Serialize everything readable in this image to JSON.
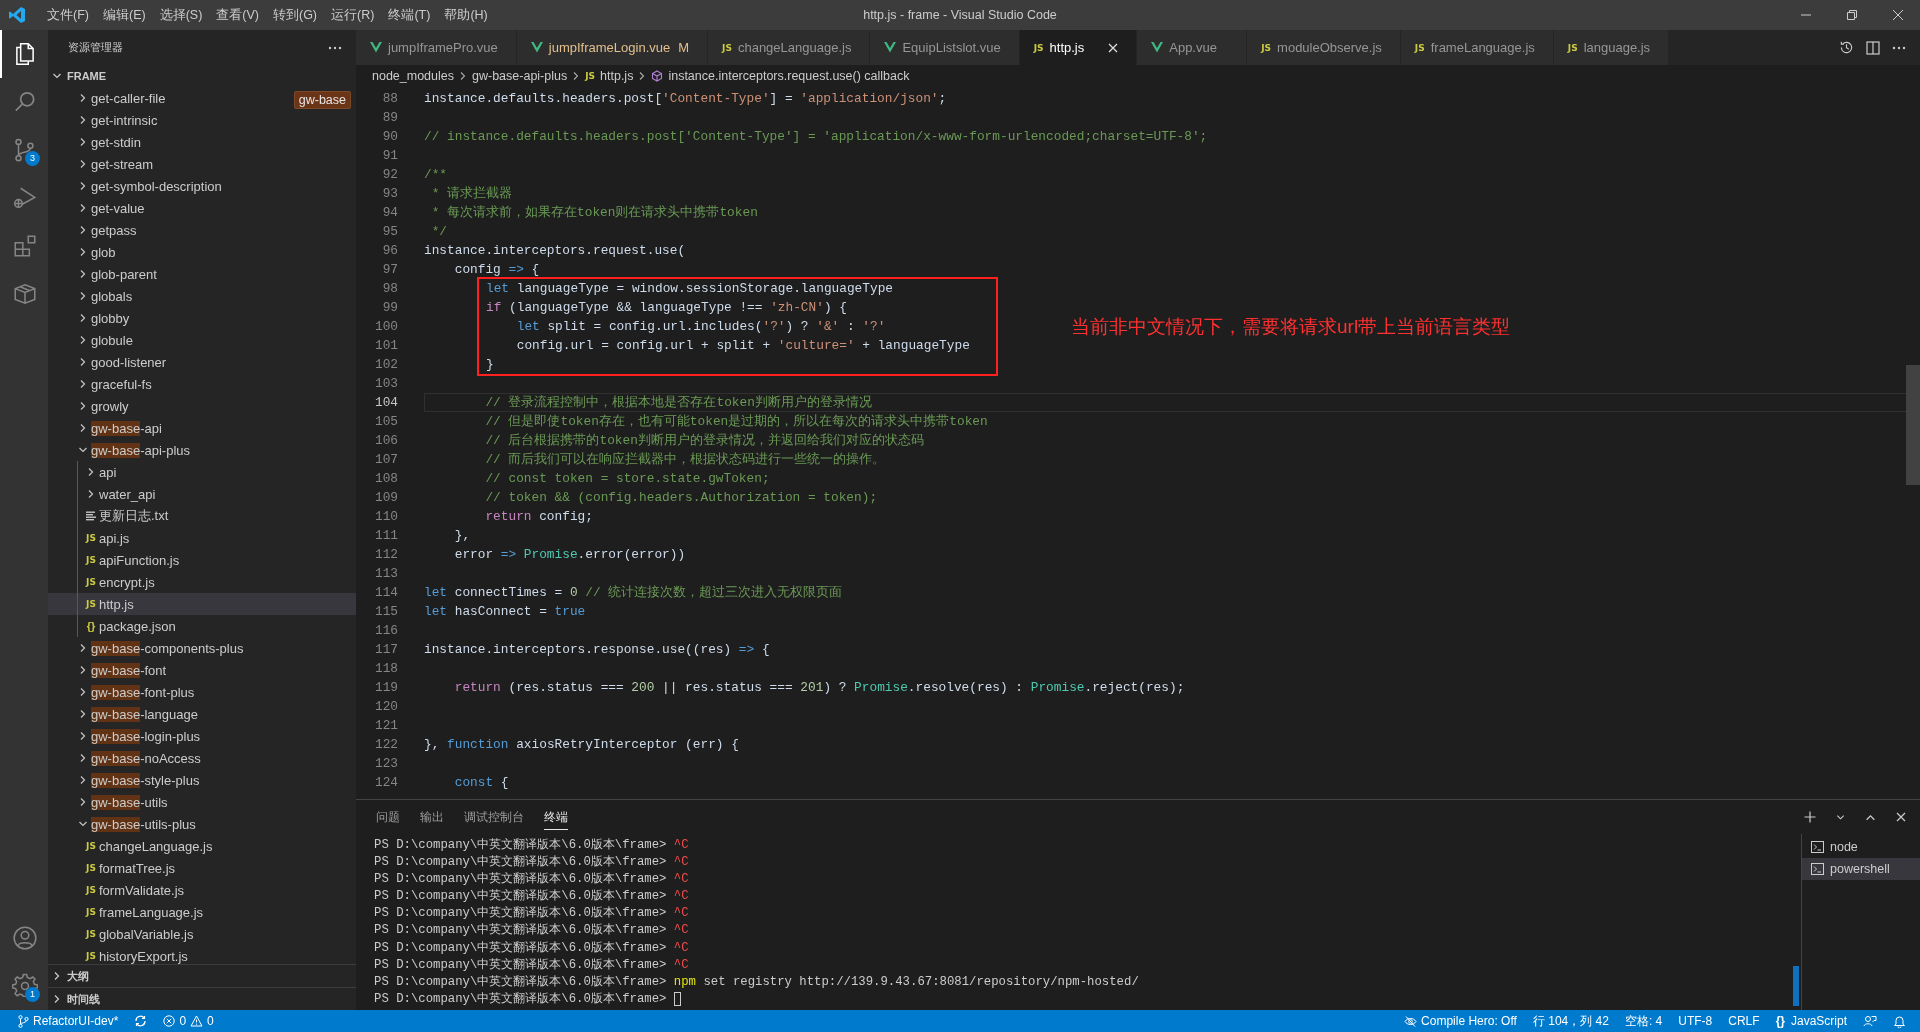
{
  "window": {
    "title": "http.js - frame - Visual Studio Code"
  },
  "menu": [
    "文件(F)",
    "编辑(E)",
    "选择(S)",
    "查看(V)",
    "转到(G)",
    "运行(R)",
    "终端(T)",
    "帮助(H)"
  ],
  "activity_bar": [
    {
      "kind": "explorer",
      "selected": true
    },
    {
      "kind": "search",
      "selected": false
    },
    {
      "kind": "scm",
      "selected": false,
      "badge": "3"
    },
    {
      "kind": "run",
      "selected": false
    },
    {
      "kind": "extensions",
      "selected": false
    },
    {
      "kind": "package",
      "selected": false
    }
  ],
  "activity_bottom": [
    {
      "kind": "account"
    },
    {
      "kind": "settings",
      "badge": "1"
    }
  ],
  "sidebar": {
    "title": "资源管理器",
    "section": "FRAME",
    "filter_badge": "gw-base",
    "tree": [
      {
        "kind": "folder",
        "label": "get-caller-file",
        "expanded": false
      },
      {
        "kind": "folder",
        "label": "get-intrinsic",
        "expanded": false
      },
      {
        "kind": "folder",
        "label": "get-stdin",
        "expanded": false
      },
      {
        "kind": "folder",
        "label": "get-stream",
        "expanded": false
      },
      {
        "kind": "folder",
        "label": "get-symbol-description",
        "expanded": false
      },
      {
        "kind": "folder",
        "label": "get-value",
        "expanded": false
      },
      {
        "kind": "folder",
        "label": "getpass",
        "expanded": false
      },
      {
        "kind": "folder",
        "label": "glob",
        "expanded": false
      },
      {
        "kind": "folder",
        "label": "glob-parent",
        "expanded": false
      },
      {
        "kind": "folder",
        "label": "globals",
        "expanded": false
      },
      {
        "kind": "folder",
        "label": "globby",
        "expanded": false
      },
      {
        "kind": "folder",
        "label": "globule",
        "expanded": false
      },
      {
        "kind": "folder",
        "label": "good-listener",
        "expanded": false
      },
      {
        "kind": "folder",
        "label": "graceful-fs",
        "expanded": false
      },
      {
        "kind": "folder",
        "label": "growly",
        "expanded": false
      },
      {
        "kind": "folder",
        "match": "gw-base",
        "label": "-api",
        "expanded": false
      },
      {
        "kind": "folder",
        "match": "gw-base",
        "label": "-api-plus",
        "expanded": true,
        "children": [
          {
            "kind": "folder",
            "label": "api",
            "expanded": false
          },
          {
            "kind": "folder",
            "label": "water_api",
            "expanded": false
          },
          {
            "kind": "txt",
            "label": "更新日志.txt",
            "selected": false
          },
          {
            "kind": "js",
            "icon": "JS",
            "label": "api.js",
            "selected": false
          },
          {
            "kind": "js",
            "icon": "JS",
            "label": "apiFunction.js",
            "selected": false
          },
          {
            "kind": "js",
            "icon": "JS",
            "label": "encrypt.js",
            "selected": false
          },
          {
            "kind": "js",
            "icon": "JS",
            "label": "http.js",
            "selected": true
          },
          {
            "kind": "json",
            "icon": "{}",
            "label": "package.json",
            "selected": false
          }
        ]
      },
      {
        "kind": "folder",
        "match": "gw-base",
        "label": "-components-plus",
        "expanded": false
      },
      {
        "kind": "folder",
        "match": "gw-base",
        "label": "-font",
        "expanded": false
      },
      {
        "kind": "folder",
        "match": "gw-base",
        "label": "-font-plus",
        "expanded": false
      },
      {
        "kind": "folder",
        "match": "gw-base",
        "label": "-language",
        "expanded": false
      },
      {
        "kind": "folder",
        "match": "gw-base",
        "label": "-login-plus",
        "expanded": false
      },
      {
        "kind": "folder",
        "match": "gw-base",
        "label": "-noAccess",
        "expanded": false
      },
      {
        "kind": "folder",
        "match": "gw-base",
        "label": "-style-plus",
        "expanded": false
      },
      {
        "kind": "folder",
        "match": "gw-base",
        "label": "-utils",
        "expanded": false
      },
      {
        "kind": "folder",
        "match": "gw-base",
        "label": "-utils-plus",
        "expanded": true,
        "children": [
          {
            "kind": "js",
            "icon": "JS",
            "label": "changeLanguage.js",
            "selected": false
          },
          {
            "kind": "js",
            "icon": "JS",
            "label": "formatTree.js",
            "selected": false
          },
          {
            "kind": "js",
            "icon": "JS",
            "label": "formValidate.js",
            "selected": false
          },
          {
            "kind": "js",
            "icon": "JS",
            "label": "frameLanguage.js",
            "selected": false
          },
          {
            "kind": "js",
            "icon": "JS",
            "label": "globalVariable.js",
            "selected": false
          },
          {
            "kind": "js",
            "icon": "JS",
            "label": "historyExport.js",
            "selected": false
          }
        ]
      }
    ],
    "bottom_sections": [
      {
        "label": "大纲",
        "expanded": false
      },
      {
        "label": "时间线",
        "expanded": false
      }
    ]
  },
  "tabs": [
    {
      "label": "jumpIframePro.vue",
      "kind": "vue",
      "modified": false,
      "selected": false
    },
    {
      "label": "jumpIframeLogin.vue",
      "kind": "vue",
      "modified": true,
      "status": "M",
      "selected": false
    },
    {
      "label": "changeLanguage.js",
      "kind": "js",
      "icon": "JS",
      "modified": false,
      "selected": false
    },
    {
      "label": "EquipListslot.vue",
      "kind": "vue",
      "modified": false,
      "selected": false
    },
    {
      "label": "http.js",
      "kind": "js",
      "icon": "JS",
      "modified": false,
      "selected": true
    },
    {
      "label": "App.vue",
      "kind": "vue",
      "modified": false,
      "selected": false
    },
    {
      "label": "moduleObserve.js",
      "kind": "js",
      "icon": "JS",
      "modified": false,
      "selected": false
    },
    {
      "label": "frameLanguage.js",
      "kind": "js",
      "icon": "JS",
      "modified": false,
      "selected": false
    },
    {
      "label": "language.js",
      "kind": "js",
      "icon": "JS",
      "modified": false,
      "selected": false
    }
  ],
  "breadcrumbs": [
    {
      "kind": "folder",
      "text": "node_modules"
    },
    {
      "kind": "folder",
      "text": "gw-base-api-plus"
    },
    {
      "kind": "js",
      "icon": "JS",
      "text": "http.js"
    },
    {
      "kind": "symbol",
      "text": "instance.interceptors.request.use() callback"
    }
  ],
  "code": [
    {
      "kind": "line",
      "number": "88",
      "tokens": [
        {
          "kind": "plain",
          "text": "instance.defaults.headers.post["
        },
        {
          "kind": "str",
          "text": "'Content-Type'"
        },
        {
          "kind": "plain",
          "text": "] = "
        },
        {
          "kind": "str",
          "text": "'application/json'"
        },
        {
          "kind": "plain",
          "text": ";"
        }
      ]
    },
    {
      "kind": "line",
      "number": "89"
    },
    {
      "kind": "line",
      "number": "90",
      "tokens": [
        {
          "kind": "cmt",
          "text": "// instance.defaults.headers.post['Content-Type'] = 'application/x-www-form-urlencoded;charset=UTF-8';"
        }
      ]
    },
    {
      "kind": "line",
      "number": "91"
    },
    {
      "kind": "line",
      "number": "92",
      "tokens": [
        {
          "kind": "cmt",
          "text": "/**"
        }
      ]
    },
    {
      "kind": "line",
      "number": "93",
      "tokens": [
        {
          "kind": "cmt",
          "text": " * 请求拦截器"
        }
      ]
    },
    {
      "kind": "line",
      "number": "94",
      "tokens": [
        {
          "kind": "cmt",
          "text": " * 每次请求前，如果存在token则在请求头中携带token"
        }
      ]
    },
    {
      "kind": "line",
      "number": "95",
      "tokens": [
        {
          "kind": "cmt",
          "text": " */"
        }
      ]
    },
    {
      "kind": "line",
      "number": "96",
      "tokens": [
        {
          "kind": "plain",
          "text": "instance.interceptors.request.use("
        }
      ]
    },
    {
      "kind": "line",
      "number": "97",
      "tokens": [
        {
          "kind": "plain",
          "text": "    config "
        },
        {
          "kind": "kw",
          "text": "=>"
        },
        {
          "kind": "plain",
          "text": " {"
        }
      ]
    },
    {
      "kind": "annotated",
      "note": "当前非中文情况下，需要将请求url带上当前语言类型",
      "lines": [
        {
          "number": "98",
          "tokens": [
            {
              "kind": "kw",
              "text": "let"
            },
            {
              "kind": "plain",
              "text": " languageType = window.sessionStorage.languageType"
            }
          ]
        },
        {
          "number": "99",
          "tokens": [
            {
              "kind": "ctrl",
              "text": "if"
            },
            {
              "kind": "plain",
              "text": " (languageType && languageType !== "
            },
            {
              "kind": "str",
              "text": "'zh-CN'"
            },
            {
              "kind": "plain",
              "text": ") {"
            }
          ]
        },
        {
          "number": "100",
          "tokens": [
            {
              "kind": "kw",
              "text": "    let"
            },
            {
              "kind": "plain",
              "text": " split = config.url.includes("
            },
            {
              "kind": "str",
              "text": "'?'"
            },
            {
              "kind": "plain",
              "text": ") ? "
            },
            {
              "kind": "str",
              "text": "'&'"
            },
            {
              "kind": "plain",
              "text": " : "
            },
            {
              "kind": "str",
              "text": "'?'"
            }
          ]
        },
        {
          "number": "101",
          "tokens": [
            {
              "kind": "plain",
              "text": "    config.url = config.url + split + "
            },
            {
              "kind": "str",
              "text": "'culture='"
            },
            {
              "kind": "plain",
              "text": " + languageType"
            }
          ]
        },
        {
          "number": "102",
          "tokens": [
            {
              "kind": "plain",
              "text": "}"
            }
          ]
        }
      ]
    },
    {
      "kind": "line",
      "number": "103"
    },
    {
      "kind": "line",
      "number": "104",
      "current": true,
      "tokens": [
        {
          "kind": "cmt",
          "text": "        // 登录流程控制中，根据本地是否存在token判断用户的登录情况"
        }
      ]
    },
    {
      "kind": "line",
      "number": "105",
      "tokens": [
        {
          "kind": "cmt",
          "text": "        // 但是即使token存在，也有可能token是过期的，所以在每次的请求头中携带token"
        }
      ]
    },
    {
      "kind": "line",
      "number": "106",
      "tokens": [
        {
          "kind": "cmt",
          "text": "        // 后台根据携带的token判断用户的登录情况，并返回给我们对应的状态码"
        }
      ]
    },
    {
      "kind": "line",
      "number": "107",
      "tokens": [
        {
          "kind": "cmt",
          "text": "        // 而后我们可以在响应拦截器中，根据状态码进行一些统一的操作。"
        }
      ]
    },
    {
      "kind": "line",
      "number": "108",
      "tokens": [
        {
          "kind": "cmt",
          "text": "        // const token = store.state.gwToken;"
        }
      ]
    },
    {
      "kind": "line",
      "number": "109",
      "tokens": [
        {
          "kind": "cmt",
          "text": "        // token && (config.headers.Authorization = token);"
        }
      ]
    },
    {
      "kind": "line",
      "number": "110",
      "tokens": [
        {
          "kind": "ctrl",
          "text": "        return"
        },
        {
          "kind": "plain",
          "text": " config;"
        }
      ]
    },
    {
      "kind": "line",
      "number": "111",
      "tokens": [
        {
          "kind": "plain",
          "text": "    },"
        }
      ]
    },
    {
      "kind": "line",
      "number": "112",
      "tokens": [
        {
          "kind": "plain",
          "text": "    error "
        },
        {
          "kind": "kw",
          "text": "=>"
        },
        {
          "kind": "type",
          "text": " Promise"
        },
        {
          "kind": "plain",
          "text": ".error(error))"
        }
      ]
    },
    {
      "kind": "line",
      "number": "113"
    },
    {
      "kind": "line",
      "number": "114",
      "tokens": [
        {
          "kind": "kw",
          "text": "let"
        },
        {
          "kind": "plain",
          "text": " connectTimes = "
        },
        {
          "kind": "num",
          "text": "0"
        },
        {
          "kind": "cmt",
          "text": " // 统计连接次数，超过三次进入无权限页面"
        }
      ]
    },
    {
      "kind": "line",
      "number": "115",
      "tokens": [
        {
          "kind": "kw",
          "text": "let"
        },
        {
          "kind": "plain",
          "text": " hasConnect = "
        },
        {
          "kind": "kw",
          "text": "true"
        }
      ]
    },
    {
      "kind": "line",
      "number": "116"
    },
    {
      "kind": "line",
      "number": "117",
      "tokens": [
        {
          "kind": "plain",
          "text": "instance.interceptors.response.use((res) "
        },
        {
          "kind": "kw",
          "text": "=>"
        },
        {
          "kind": "plain",
          "text": " {"
        }
      ]
    },
    {
      "kind": "line",
      "number": "118"
    },
    {
      "kind": "line",
      "number": "119",
      "tokens": [
        {
          "kind": "ctrl",
          "text": "    return"
        },
        {
          "kind": "plain",
          "text": " (res.status === "
        },
        {
          "kind": "num",
          "text": "200"
        },
        {
          "kind": "plain",
          "text": " || res.status === "
        },
        {
          "kind": "num",
          "text": "201"
        },
        {
          "kind": "plain",
          "text": ") ? "
        },
        {
          "kind": "type",
          "text": "Promise"
        },
        {
          "kind": "plain",
          "text": ".resolve(res) : "
        },
        {
          "kind": "type",
          "text": "Promise"
        },
        {
          "kind": "plain",
          "text": ".reject(res);"
        }
      ]
    },
    {
      "kind": "line",
      "number": "120"
    },
    {
      "kind": "line",
      "number": "121"
    },
    {
      "kind": "line",
      "number": "122",
      "tokens": [
        {
          "kind": "plain",
          "text": "}, "
        },
        {
          "kind": "kw",
          "text": "function"
        },
        {
          "kind": "plain",
          "text": " axiosRetryInterceptor (err) {"
        }
      ]
    },
    {
      "kind": "line",
      "number": "123"
    },
    {
      "kind": "line",
      "number": "124",
      "tokens": [
        {
          "kind": "kw",
          "text": "    const"
        },
        {
          "kind": "plain",
          "text": " {"
        }
      ]
    }
  ],
  "panel": {
    "tabs": [
      {
        "label": "问题",
        "selected": false
      },
      {
        "label": "输出",
        "selected": false
      },
      {
        "label": "调试控制台",
        "selected": false
      },
      {
        "label": "终端",
        "selected": true
      }
    ],
    "terminal": [
      {
        "kind": "interrupt",
        "prompt": "PS D:\\company\\中英文翻译版本\\6.0版本\\frame>",
        "text": "^C"
      },
      {
        "kind": "interrupt",
        "prompt": "PS D:\\company\\中英文翻译版本\\6.0版本\\frame>",
        "text": "^C"
      },
      {
        "kind": "interrupt",
        "prompt": "PS D:\\company\\中英文翻译版本\\6.0版本\\frame>",
        "text": "^C"
      },
      {
        "kind": "interrupt",
        "prompt": "PS D:\\company\\中英文翻译版本\\6.0版本\\frame>",
        "text": "^C"
      },
      {
        "kind": "interrupt",
        "prompt": "PS D:\\company\\中英文翻译版本\\6.0版本\\frame>",
        "text": "^C"
      },
      {
        "kind": "interrupt",
        "prompt": "PS D:\\company\\中英文翻译版本\\6.0版本\\frame>",
        "text": "^C"
      },
      {
        "kind": "interrupt",
        "prompt": "PS D:\\company\\中英文翻译版本\\6.0版本\\frame>",
        "text": "^C"
      },
      {
        "kind": "interrupt",
        "prompt": "PS D:\\company\\中英文翻译版本\\6.0版本\\frame>",
        "text": "^C"
      },
      {
        "kind": "command",
        "prompt": "PS D:\\company\\中英文翻译版本\\6.0版本\\frame>",
        "program": "npm",
        "text": "set registry http://139.9.43.67:8081/repository/npm-hosted/"
      },
      {
        "kind": "input",
        "prompt": "PS D:\\company\\中英文翻译版本\\6.0版本\\frame>"
      }
    ],
    "terminals": [
      {
        "label": "node",
        "selected": false
      },
      {
        "label": "powershell",
        "selected": true
      }
    ]
  },
  "status_bar": {
    "left": [
      {
        "kind": "branch",
        "text": "RefactorUI-dev*"
      },
      {
        "kind": "sync"
      },
      {
        "kind": "problems",
        "errors": "0",
        "warnings": "0"
      }
    ],
    "right": [
      {
        "kind": "compile",
        "text": "Compile Hero: Off"
      },
      {
        "kind": "text",
        "text": "行 104，列 42"
      },
      {
        "kind": "text",
        "text": "空格: 4"
      },
      {
        "kind": "text",
        "text": "UTF-8"
      },
      {
        "kind": "text",
        "text": "CRLF"
      },
      {
        "kind": "language",
        "icon": "{}",
        "text": "JavaScript"
      },
      {
        "kind": "feedback"
      },
      {
        "kind": "bell"
      }
    ]
  }
}
